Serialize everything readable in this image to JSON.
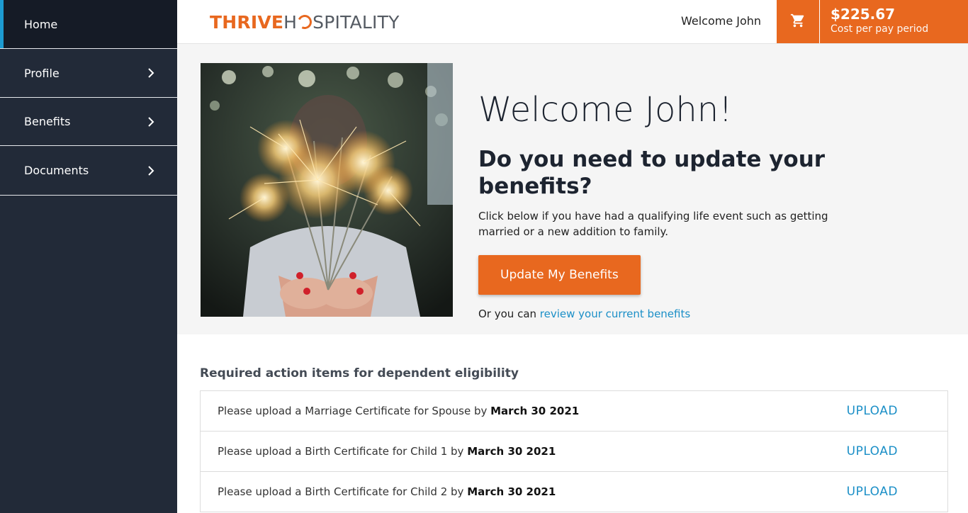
{
  "sidebar": {
    "items": [
      {
        "label": "Home",
        "active": true
      },
      {
        "label": "Profile",
        "icon": "chevron-right-icon"
      },
      {
        "label": "Benefits",
        "icon": "chevron-right-icon"
      },
      {
        "label": "Documents",
        "icon": "chevron-right-icon"
      }
    ]
  },
  "header": {
    "logo_thrive": "THRIVE",
    "logo_h": "H",
    "logo_rest": "SPITALITY",
    "welcome": "Welcome John",
    "cart_icon": "cart-icon",
    "cost_amount": "$225.67",
    "cost_label": "Cost per pay period"
  },
  "hero": {
    "image_icon": "sparklers-photo",
    "title": "Welcome John!",
    "question": "Do you need to update your benefits?",
    "description": "Click below if you have had a qualifying life event such as getting married or a new addition to family.",
    "button_label": "Update My Benefits",
    "review_prefix": "Or you can ",
    "review_link": "review your current benefits"
  },
  "actions": {
    "title": "Required action items for dependent eligibility",
    "rows": [
      {
        "text": "Please upload a Marriage Certificate for Spouse by ",
        "date": "March 30 2021",
        "action": "UPLOAD"
      },
      {
        "text": "Please upload a Birth Certificate for Child 1 by ",
        "date": "March 30 2021",
        "action": "UPLOAD"
      },
      {
        "text": "Please upload a Birth Certificate for Child 2 by ",
        "date": "March 30 2021",
        "action": "UPLOAD"
      }
    ]
  },
  "colors": {
    "brand_orange": "#e8681f",
    "sidebar_bg": "#222a38",
    "link_blue": "#1b8fc7"
  }
}
